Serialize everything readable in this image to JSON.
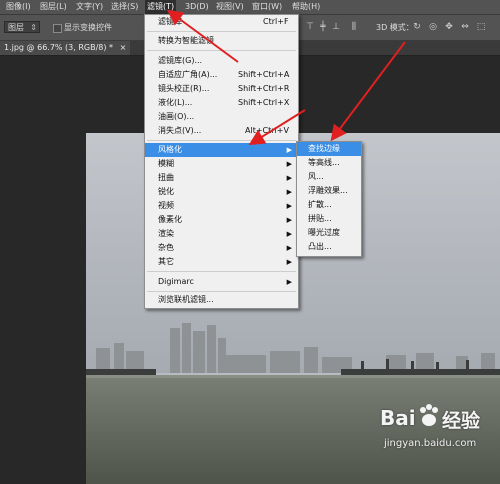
{
  "menubar": {
    "items": [
      "图像(I)",
      "图层(L)",
      "文字(Y)",
      "选择(S)",
      "滤镜(T)",
      "3D(D)",
      "视图(V)",
      "窗口(W)",
      "帮助(H)"
    ],
    "active_index": 4
  },
  "optbar": {
    "layer_select": "图层",
    "show_transform_label": "显示变换控件",
    "mode_3d_label": "3D 模式："
  },
  "doc_tab": {
    "title": "1.jpg @ 66.7% (3, RGB/8) *",
    "close": "×"
  },
  "filter_menu": {
    "items": [
      {
        "label": "滤镜库",
        "shortcut": "Ctrl+F"
      },
      {
        "label": "转换为智能滤镜",
        "shortcut": ""
      },
      {
        "label": "滤镜库(G)...",
        "shortcut": ""
      },
      {
        "label": "自适应广角(A)...",
        "shortcut": "Shift+Ctrl+A"
      },
      {
        "label": "镜头校正(R)...",
        "shortcut": "Shift+Ctrl+R"
      },
      {
        "label": "液化(L)...",
        "shortcut": "Shift+Ctrl+X"
      },
      {
        "label": "油画(O)...",
        "shortcut": ""
      },
      {
        "label": "消失点(V)...",
        "shortcut": "Alt+Ctrl+V"
      },
      {
        "label": "风格化",
        "submenu": true
      },
      {
        "label": "模糊",
        "submenu": true
      },
      {
        "label": "扭曲",
        "submenu": true
      },
      {
        "label": "锐化",
        "submenu": true
      },
      {
        "label": "视频",
        "submenu": true
      },
      {
        "label": "像素化",
        "submenu": true
      },
      {
        "label": "渲染",
        "submenu": true
      },
      {
        "label": "杂色",
        "submenu": true
      },
      {
        "label": "其它",
        "submenu": true
      },
      {
        "label": "Digimarc",
        "submenu": true
      },
      {
        "label": "浏览联机滤镜...",
        "shortcut": ""
      }
    ]
  },
  "stylize_submenu": {
    "items": [
      "查找边缘",
      "等高线...",
      "风...",
      "浮雕效果...",
      "扩散...",
      "拼贴...",
      "曝光过度",
      "凸出..."
    ]
  },
  "watermark": {
    "brand_left": "Bai",
    "brand_right": "经验",
    "url": "jingyan.baidu.com"
  },
  "colors": {
    "highlight": "#3a8ee6",
    "annotation_arrow": "#e02020"
  }
}
